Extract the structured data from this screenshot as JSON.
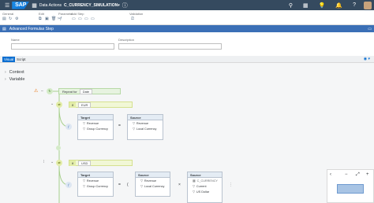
{
  "shell": {
    "app": "Data Actions",
    "object": "C_CURRENCY_SIMULATION"
  },
  "toolbar": {
    "groups": [
      "General",
      "Edit",
      "Parameter",
      "Add Step",
      "Validation"
    ]
  },
  "titlebar": {
    "title": "Advanced Formulas Step"
  },
  "form": {
    "name_label": "Name",
    "description_label": "Description",
    "name_value": "",
    "description_value": ""
  },
  "tabs": {
    "visual": "Visual",
    "script": "Script"
  },
  "tree": {
    "context": "Context",
    "variable": "Variable"
  },
  "flow": {
    "repeat": {
      "label": "Repeat for",
      "value": "Date"
    },
    "if1": {
      "label": "if",
      "value": "EUR"
    },
    "if2": {
      "label": "if",
      "value": "USD"
    },
    "block1": {
      "target": {
        "title": "Target",
        "rows": [
          "Revenue",
          "Group Currency"
        ]
      },
      "op": "=",
      "source": {
        "title": "Source",
        "rows": [
          "Revenue",
          "Local Currency"
        ]
      }
    },
    "block2": {
      "target": {
        "title": "Target",
        "rows": [
          "Revenue",
          "Group Currency"
        ]
      },
      "op1": "=",
      "paren": "(",
      "source1": {
        "title": "Source",
        "rows": [
          "Revenue",
          "Local Currency"
        ]
      },
      "op2": "×",
      "source2": {
        "title": "Source",
        "model": "C_CURRENCY",
        "rows": [
          "Current",
          "US Dollar"
        ]
      }
    }
  },
  "zoom": {
    "minus": "−",
    "plus": "+"
  }
}
